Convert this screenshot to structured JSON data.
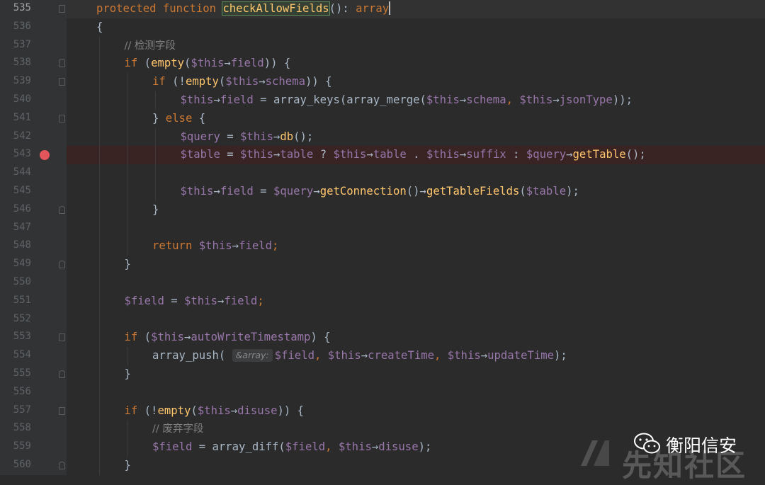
{
  "editor": {
    "current_line": "535",
    "breakpoint_line": "543",
    "lines": [
      {
        "no": "535",
        "indent": 1,
        "tokens": [
          [
            "kw",
            "protected "
          ],
          [
            "kw",
            "function "
          ],
          [
            "hl",
            "checkAllowFields"
          ],
          [
            "plain",
            "(): "
          ],
          [
            "kw",
            "array"
          ]
        ]
      },
      {
        "no": "536",
        "indent": 1,
        "tokens": [
          [
            "plain",
            "{"
          ]
        ]
      },
      {
        "no": "537",
        "indent": 2,
        "tokens": [
          [
            "cmt",
            "// 检测字段"
          ]
        ]
      },
      {
        "no": "538",
        "indent": 2,
        "tokens": [
          [
            "kw",
            "if "
          ],
          [
            "plain",
            "("
          ],
          [
            "fn",
            "empty"
          ],
          [
            "plain",
            "("
          ],
          [
            "var",
            "$this"
          ],
          [
            "plain",
            "→"
          ],
          [
            "prop",
            "field"
          ],
          [
            "plain",
            ")) {"
          ]
        ]
      },
      {
        "no": "539",
        "indent": 3,
        "tokens": [
          [
            "kw",
            "if "
          ],
          [
            "plain",
            "(!"
          ],
          [
            "fn",
            "empty"
          ],
          [
            "plain",
            "("
          ],
          [
            "var",
            "$this"
          ],
          [
            "plain",
            "→"
          ],
          [
            "prop",
            "schema"
          ],
          [
            "plain",
            ")) {"
          ]
        ]
      },
      {
        "no": "540",
        "indent": 4,
        "tokens": [
          [
            "var",
            "$this"
          ],
          [
            "plain",
            "→"
          ],
          [
            "prop",
            "field"
          ],
          [
            "plain",
            " = array_keys(array_merge("
          ],
          [
            "var",
            "$this"
          ],
          [
            "plain",
            "→"
          ],
          [
            "prop",
            "schema"
          ],
          [
            "kw",
            ", "
          ],
          [
            "var",
            "$this"
          ],
          [
            "plain",
            "→"
          ],
          [
            "prop",
            "jsonType"
          ],
          [
            "plain",
            "));"
          ]
        ]
      },
      {
        "no": "541",
        "indent": 3,
        "tokens": [
          [
            "plain",
            "} "
          ],
          [
            "kw",
            "else "
          ],
          [
            "plain",
            "{"
          ]
        ]
      },
      {
        "no": "542",
        "indent": 4,
        "tokens": [
          [
            "var",
            "$query"
          ],
          [
            "plain",
            " = "
          ],
          [
            "var",
            "$this"
          ],
          [
            "plain",
            "→"
          ],
          [
            "fn",
            "db"
          ],
          [
            "plain",
            "();"
          ]
        ]
      },
      {
        "no": "543",
        "indent": 4,
        "tokens": [
          [
            "var",
            "$table"
          ],
          [
            "plain",
            " = "
          ],
          [
            "var",
            "$this"
          ],
          [
            "plain",
            "→"
          ],
          [
            "prop",
            "table"
          ],
          [
            "plain",
            " ? "
          ],
          [
            "var",
            "$this"
          ],
          [
            "plain",
            "→"
          ],
          [
            "prop",
            "table"
          ],
          [
            "plain",
            " . "
          ],
          [
            "var",
            "$this"
          ],
          [
            "plain",
            "→"
          ],
          [
            "prop",
            "suffix"
          ],
          [
            "plain",
            " : "
          ],
          [
            "var",
            "$query"
          ],
          [
            "plain",
            "→"
          ],
          [
            "fn",
            "getTable"
          ],
          [
            "plain",
            "();"
          ]
        ]
      },
      {
        "no": "544",
        "indent": 4,
        "tokens": []
      },
      {
        "no": "545",
        "indent": 4,
        "tokens": [
          [
            "var",
            "$this"
          ],
          [
            "plain",
            "→"
          ],
          [
            "prop",
            "field"
          ],
          [
            "plain",
            " = "
          ],
          [
            "var",
            "$query"
          ],
          [
            "plain",
            "→"
          ],
          [
            "fn",
            "getConnection"
          ],
          [
            "plain",
            "()→"
          ],
          [
            "fn",
            "getTableFields"
          ],
          [
            "plain",
            "("
          ],
          [
            "var",
            "$table"
          ],
          [
            "plain",
            ");"
          ]
        ]
      },
      {
        "no": "546",
        "indent": 3,
        "tokens": [
          [
            "plain",
            "}"
          ]
        ]
      },
      {
        "no": "547",
        "indent": 3,
        "tokens": []
      },
      {
        "no": "548",
        "indent": 3,
        "tokens": [
          [
            "kw",
            "return "
          ],
          [
            "var",
            "$this"
          ],
          [
            "plain",
            "→"
          ],
          [
            "prop",
            "field"
          ],
          [
            "kw",
            ";"
          ]
        ]
      },
      {
        "no": "549",
        "indent": 2,
        "tokens": [
          [
            "plain",
            "}"
          ]
        ]
      },
      {
        "no": "550",
        "indent": 2,
        "tokens": []
      },
      {
        "no": "551",
        "indent": 2,
        "tokens": [
          [
            "var",
            "$field"
          ],
          [
            "plain",
            " = "
          ],
          [
            "var",
            "$this"
          ],
          [
            "plain",
            "→"
          ],
          [
            "prop",
            "field"
          ],
          [
            "kw",
            ";"
          ]
        ]
      },
      {
        "no": "552",
        "indent": 2,
        "tokens": []
      },
      {
        "no": "553",
        "indent": 2,
        "tokens": [
          [
            "kw",
            "if "
          ],
          [
            "plain",
            "("
          ],
          [
            "var",
            "$this"
          ],
          [
            "plain",
            "→"
          ],
          [
            "prop",
            "autoWriteTimestamp"
          ],
          [
            "plain",
            ") {"
          ]
        ]
      },
      {
        "no": "554",
        "indent": 3,
        "tokens": [
          [
            "plain",
            "array_push( "
          ],
          [
            "hint",
            "&array:"
          ],
          [
            "var",
            "$field"
          ],
          [
            "kw",
            ", "
          ],
          [
            "var",
            "$this"
          ],
          [
            "plain",
            "→"
          ],
          [
            "prop",
            "createTime"
          ],
          [
            "kw",
            ", "
          ],
          [
            "var",
            "$this"
          ],
          [
            "plain",
            "→"
          ],
          [
            "prop",
            "updateTime"
          ],
          [
            "plain",
            ");"
          ]
        ]
      },
      {
        "no": "555",
        "indent": 2,
        "tokens": [
          [
            "plain",
            "}"
          ]
        ]
      },
      {
        "no": "556",
        "indent": 2,
        "tokens": []
      },
      {
        "no": "557",
        "indent": 2,
        "tokens": [
          [
            "kw",
            "if "
          ],
          [
            "plain",
            "(!"
          ],
          [
            "fn",
            "empty"
          ],
          [
            "plain",
            "("
          ],
          [
            "var",
            "$this"
          ],
          [
            "plain",
            "→"
          ],
          [
            "prop",
            "disuse"
          ],
          [
            "plain",
            ")) {"
          ]
        ]
      },
      {
        "no": "558",
        "indent": 3,
        "tokens": [
          [
            "cmt",
            "// 废弃字段"
          ]
        ]
      },
      {
        "no": "559",
        "indent": 3,
        "tokens": [
          [
            "var",
            "$field"
          ],
          [
            "plain",
            " = array_diff("
          ],
          [
            "var",
            "$field"
          ],
          [
            "kw",
            ", "
          ],
          [
            "var",
            "$this"
          ],
          [
            "plain",
            "→"
          ],
          [
            "prop",
            "disuse"
          ],
          [
            "plain",
            ");"
          ]
        ]
      },
      {
        "no": "560",
        "indent": 2,
        "tokens": [
          [
            "plain",
            "}"
          ]
        ]
      }
    ],
    "fold_markers": {
      "535": "start",
      "538": "start",
      "539": "start",
      "541": "start",
      "546": "end",
      "549": "end",
      "553": "start",
      "555": "end",
      "557": "start",
      "560": "end"
    }
  },
  "watermark": {
    "wechat_name": "衡阳信安",
    "community_name": "先知社区",
    "icon": "wechat-icon",
    "logo": "xianzhi-logo"
  },
  "colors": {
    "background": "#2b2b2b",
    "gutter": "#313335",
    "keyword": "#cc7832",
    "function": "#ffc66d",
    "variable": "#9876aa",
    "breakpoint": "#e0565b"
  }
}
